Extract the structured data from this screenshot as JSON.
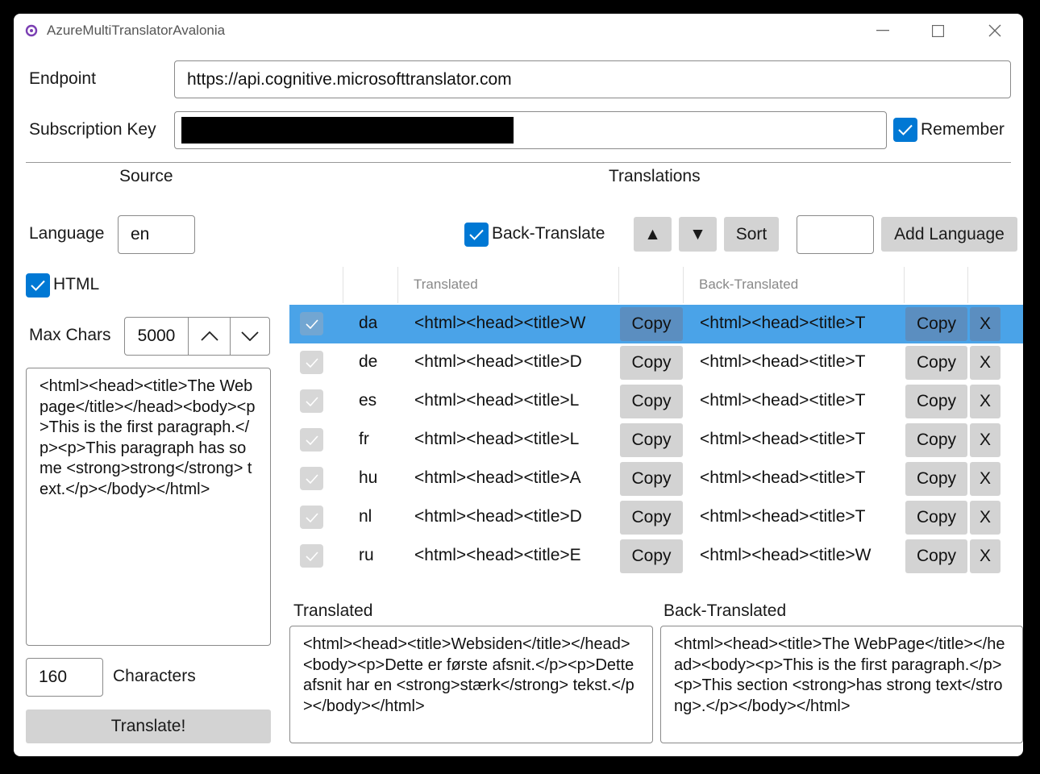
{
  "window": {
    "title": "AzureMultiTranslatorAvalonia"
  },
  "endpoint": {
    "label": "Endpoint",
    "value": "https://api.cognitive.microsofttranslator.com"
  },
  "subscription": {
    "label": "Subscription Key",
    "remember_label": "Remember",
    "remember_checked": true
  },
  "source": {
    "heading": "Source",
    "language_label": "Language",
    "language_value": "en",
    "html_label": "HTML",
    "html_checked": true,
    "max_chars_label": "Max Chars",
    "max_chars_value": "5000",
    "text": "<html><head><title>The Webpage</title></head><body><p>This is the first paragraph.</p><p>This paragraph has some <strong>strong</strong> text.</p></body></html>",
    "char_count": "160",
    "characters_label": "Characters",
    "translate_button": "Translate!"
  },
  "translations": {
    "heading": "Translations",
    "back_translate_label": "Back-Translate",
    "back_translate_checked": true,
    "up_symbol": "▲",
    "down_symbol": "▼",
    "sort_label": "Sort",
    "new_language_value": "",
    "add_language_label": "Add Language",
    "columns": {
      "translated": "Translated",
      "back_translated": "Back-Translated"
    },
    "copy_label": "Copy",
    "remove_label": "X",
    "rows": [
      {
        "lang": "da",
        "translated": "<html><head><title>W",
        "back": "<html><head><title>T",
        "selected": true
      },
      {
        "lang": "de",
        "translated": "<html><head><title>D",
        "back": "<html><head><title>T",
        "selected": false
      },
      {
        "lang": "es",
        "translated": "<html><head><title>L",
        "back": "<html><head><title>T",
        "selected": false
      },
      {
        "lang": "fr",
        "translated": "<html><head><title>L",
        "back": "<html><head><title>T",
        "selected": false
      },
      {
        "lang": "hu",
        "translated": "<html><head><title>A",
        "back": "<html><head><title>T",
        "selected": false
      },
      {
        "lang": "nl",
        "translated": "<html><head><title>D",
        "back": "<html><head><title>T",
        "selected": false
      },
      {
        "lang": "ru",
        "translated": "<html><head><title>E",
        "back": "<html><head><title>W",
        "selected": false
      }
    ]
  },
  "detail": {
    "translated_label": "Translated",
    "translated_text": "<html><head><title>Websiden</title></head><body><p>Dette er første afsnit.</p><p>Dette afsnit har en <strong>stærk</strong> tekst.</p></body></html>",
    "back_label": "Back-Translated",
    "back_text": "<html><head><title>The WebPage</title></head><body><p>This is the first paragraph.</p><p>This section <strong>has strong text</strong>.</p></body></html>"
  },
  "colors": {
    "accent": "#0078d4",
    "selection": "#4aa3e8",
    "button": "#d3d3d3"
  }
}
